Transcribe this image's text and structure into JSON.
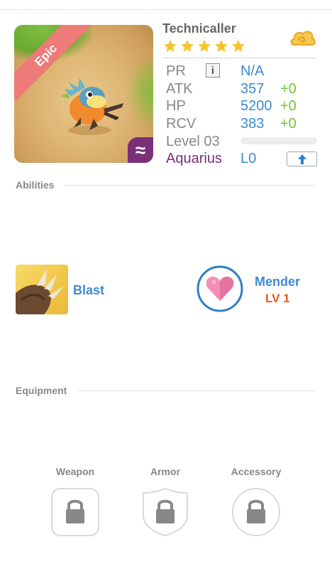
{
  "monster": {
    "name": "Technicaller",
    "rarity": "Epic",
    "stars": 5,
    "element_symbol": "≈",
    "colors": {
      "rarity_ribbon": "#ee7b78",
      "element_badge": "#7a2f78",
      "star": "#f7c22b"
    }
  },
  "stats": {
    "pr": {
      "label": "PR",
      "value": "N/A"
    },
    "atk": {
      "label": "ATK",
      "value": "357",
      "bonus": "+0"
    },
    "hp": {
      "label": "HP",
      "value": "5200",
      "bonus": "+0"
    },
    "rcv": {
      "label": "RCV",
      "value": "383",
      "bonus": "+0"
    },
    "level": {
      "label": "Level 03",
      "progress": 0
    },
    "sign": {
      "label": "Aquarius",
      "level": "L0"
    }
  },
  "icons": {
    "info": "i",
    "currency": "coin-cloud-icon",
    "upgrade": "up-arrow-icon"
  },
  "sections": {
    "abilities_title": "Abilities",
    "equipment_title": "Equipment"
  },
  "abilities": {
    "primary": {
      "name": "Blast",
      "icon": "claw-icon"
    },
    "leader": {
      "name": "Mender",
      "level": "LV 1",
      "icon": "heart-icon"
    }
  },
  "equipment": {
    "slots": [
      {
        "label": "Weapon",
        "icon": "lock-icon"
      },
      {
        "label": "Armor",
        "icon": "lock-icon"
      },
      {
        "label": "Accessory",
        "icon": "lock-icon"
      }
    ]
  }
}
